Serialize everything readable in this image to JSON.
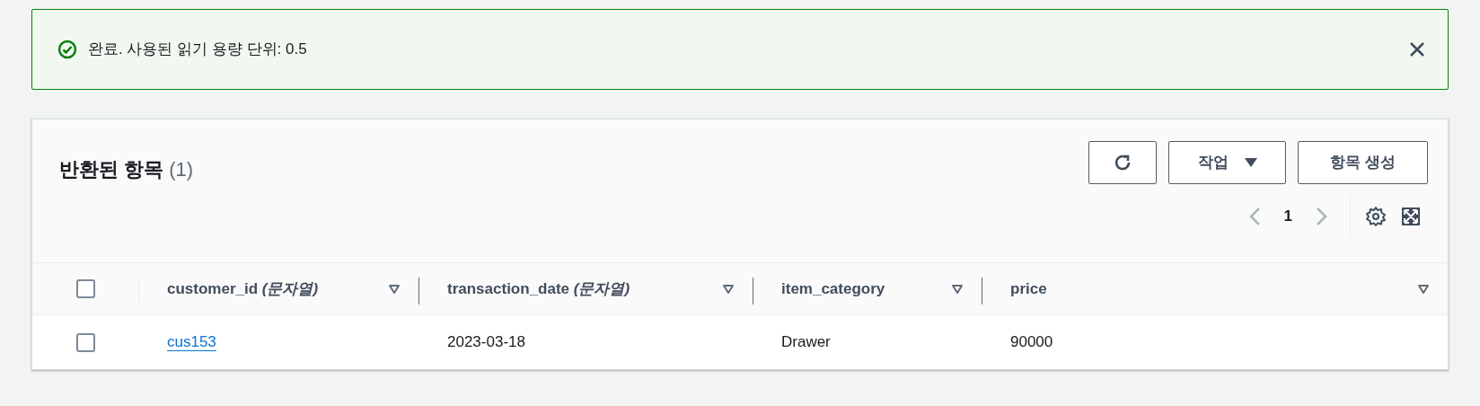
{
  "alert": {
    "kind": "success",
    "message": "완료. 사용된 읽기 용량 단위: 0.5"
  },
  "panel": {
    "title": "반환된 항목",
    "count": "(1)",
    "buttons": [
      {
        "kind": "refresh"
      },
      {
        "kind": "dropdown",
        "label": "작업"
      },
      {
        "kind": "plain",
        "label": "항목 생성"
      }
    ],
    "pagination": {
      "page": "1",
      "prev_disabled": true,
      "next_disabled": true
    }
  },
  "table": {
    "select_all_checked": false,
    "columns": [
      {
        "label": "customer_id *(문자열)*"
      },
      {
        "label": "transaction_date *(문자열)*"
      },
      {
        "label": "item_category"
      },
      {
        "label": "price"
      }
    ],
    "rows": [
      {
        "checked": false,
        "cells": [
          {
            "text": "cus153",
            "kind": "link"
          },
          {
            "text": "2023-03-18",
            "kind": "text"
          },
          {
            "text": "Drawer",
            "kind": "text"
          },
          {
            "text": "90000",
            "kind": "text"
          }
        ]
      }
    ]
  }
}
